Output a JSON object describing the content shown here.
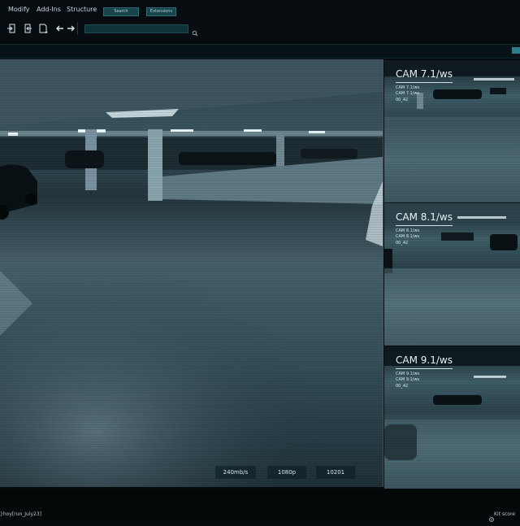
{
  "menu": {
    "items": [
      "Modify",
      "Add-Ins",
      "Structure"
    ],
    "search_label": "Search",
    "extensions_label": "Extensions"
  },
  "toolbar": {
    "buttons": [
      "page-import-icon",
      "page-export-icon",
      "page-add-icon",
      "arrow-left-icon",
      "arrow-right-icon",
      "search-icon"
    ],
    "address_value": ""
  },
  "main_view": {
    "badges": [
      "240mb/s",
      "1080p",
      "10201"
    ]
  },
  "cameras": [
    {
      "title": "CAM 7.1/ws",
      "lines": [
        "CAM 7.1/ws",
        "CAM 7.1/ws",
        "00_42"
      ]
    },
    {
      "title": "CAM 8.1/ws",
      "lines": [
        "CAM 8.1/ws",
        "CAM 8.1/ws",
        "00_42"
      ]
    },
    {
      "title": "CAM 9.1/ws",
      "lines": [
        "CAM 9.1/ws",
        "CAM 9.1/ws",
        "00_42"
      ]
    }
  ],
  "status": {
    "left_text": "}hoy[run_July23]",
    "right_text": "Kit score"
  },
  "colors": {
    "accent": "#2e7c88",
    "background": "#050a0d",
    "chip": "#18444c"
  }
}
